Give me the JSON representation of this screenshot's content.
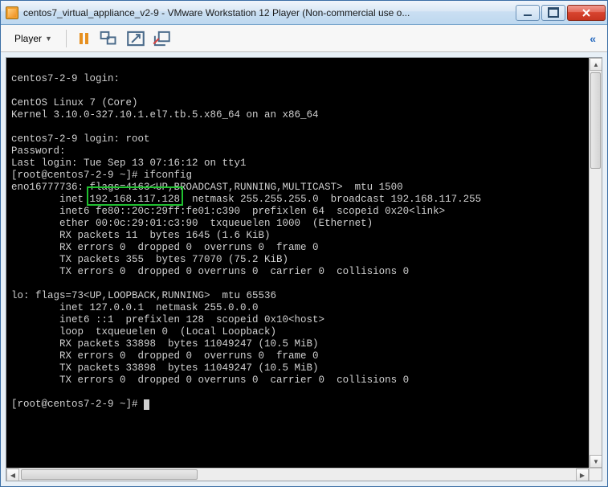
{
  "window": {
    "title": "centos7_virtual_appliance_v2-9 - VMware Workstation 12 Player (Non-commercial use o..."
  },
  "toolbar": {
    "player_label": "Player"
  },
  "highlight": {
    "ip": "192.168.117.128"
  },
  "terminal": {
    "lines": [
      "",
      "centos7-2-9 login:",
      "",
      "CentOS Linux 7 (Core)",
      "Kernel 3.10.0-327.10.1.el7.tb.5.x86_64 on an x86_64",
      "",
      "centos7-2-9 login: root",
      "Password:",
      "Last login: Tue Sep 13 07:16:12 on tty1",
      "[root@centos7-2-9 ~]# ifconfig",
      "eno16777736: flags=4163<UP,BROADCAST,RUNNING,MULTICAST>  mtu 1500",
      "        inet 192.168.117.128  netmask 255.255.255.0  broadcast 192.168.117.255",
      "        inet6 fe80::20c:29ff:fe01:c390  prefixlen 64  scopeid 0x20<link>",
      "        ether 00:0c:29:01:c3:90  txqueuelen 1000  (Ethernet)",
      "        RX packets 11  bytes 1645 (1.6 KiB)",
      "        RX errors 0  dropped 0  overruns 0  frame 0",
      "        TX packets 355  bytes 77070 (75.2 KiB)",
      "        TX errors 0  dropped 0 overruns 0  carrier 0  collisions 0",
      "",
      "lo: flags=73<UP,LOOPBACK,RUNNING>  mtu 65536",
      "        inet 127.0.0.1  netmask 255.0.0.0",
      "        inet6 ::1  prefixlen 128  scopeid 0x10<host>",
      "        loop  txqueuelen 0  (Local Loopback)",
      "        RX packets 33898  bytes 11049247 (10.5 MiB)",
      "        RX errors 0  dropped 0  overruns 0  frame 0",
      "        TX packets 33898  bytes 11049247 (10.5 MiB)",
      "        TX errors 0  dropped 0 overruns 0  carrier 0  collisions 0",
      "",
      "[root@centos7-2-9 ~]# "
    ]
  }
}
